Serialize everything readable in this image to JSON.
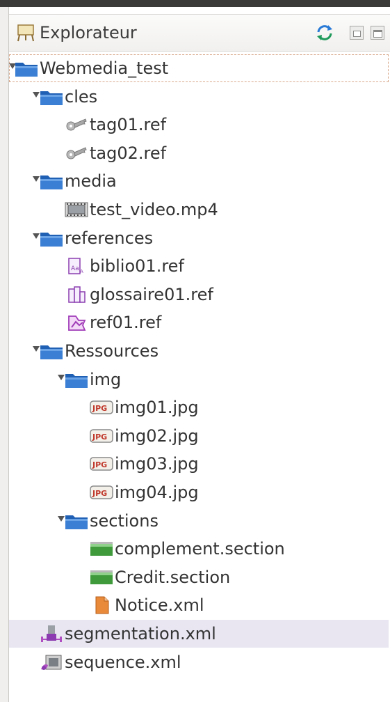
{
  "panel": {
    "title": "Explorateur",
    "icons": {
      "title": "easel-icon",
      "refresh": "sync-icon",
      "minimize": "minimize-icon",
      "maximize": "maximize-icon"
    }
  },
  "tree": {
    "nodes": [
      {
        "label": "Webmedia_test",
        "icon": "folder-icon",
        "depth": 0,
        "expanded": true
      },
      {
        "label": "cles",
        "icon": "folder-icon",
        "depth": 1,
        "expanded": true
      },
      {
        "label": "tag01.ref",
        "icon": "key-icon",
        "depth": 2
      },
      {
        "label": "tag02.ref",
        "icon": "key-icon",
        "depth": 2
      },
      {
        "label": "media",
        "icon": "folder-icon",
        "depth": 1,
        "expanded": true
      },
      {
        "label": "test_video.mp4",
        "icon": "video-file-icon",
        "depth": 2
      },
      {
        "label": "references",
        "icon": "folder-icon",
        "depth": 1,
        "expanded": true
      },
      {
        "label": "biblio01.ref",
        "icon": "bibliography-icon",
        "depth": 2
      },
      {
        "label": "glossaire01.ref",
        "icon": "glossary-icon",
        "depth": 2
      },
      {
        "label": "ref01.ref",
        "icon": "reference-icon",
        "depth": 2
      },
      {
        "label": "Ressources",
        "icon": "folder-icon",
        "depth": 1,
        "expanded": true
      },
      {
        "label": "img",
        "icon": "folder-icon",
        "depth": 2,
        "expanded": true
      },
      {
        "label": "img01.jpg",
        "icon": "jpg-file-icon",
        "depth": 3
      },
      {
        "label": "img02.jpg",
        "icon": "jpg-file-icon",
        "depth": 3
      },
      {
        "label": "img03.jpg",
        "icon": "jpg-file-icon",
        "depth": 3
      },
      {
        "label": "img04.jpg",
        "icon": "jpg-file-icon",
        "depth": 3
      },
      {
        "label": "sections",
        "icon": "folder-icon",
        "depth": 2,
        "expanded": true
      },
      {
        "label": "complement.section",
        "icon": "section-icon",
        "depth": 3
      },
      {
        "label": "Credit.section",
        "icon": "section-icon",
        "depth": 3
      },
      {
        "label": "Notice.xml",
        "icon": "xml-file-icon",
        "depth": 3
      },
      {
        "label": "segmentation.xml",
        "icon": "segmentation-icon",
        "depth": 1,
        "selected": true
      },
      {
        "label": "sequence.xml",
        "icon": "sequence-icon",
        "depth": 1
      }
    ]
  },
  "colors": {
    "folder": "#2a63b8",
    "selection": "#e9e6f2",
    "focus_border": "#d8a88a",
    "text": "#333333"
  }
}
